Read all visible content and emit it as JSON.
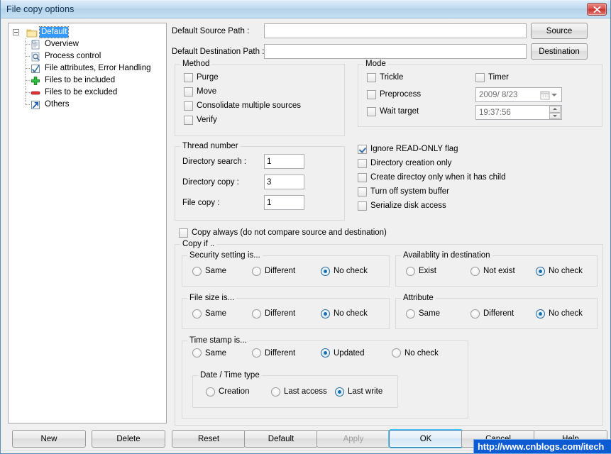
{
  "window": {
    "title": "File copy options",
    "close_icon": "close-icon"
  },
  "tree": {
    "root": {
      "label": "Default",
      "icon": "folder-icon",
      "selected": true
    },
    "items": [
      {
        "label": "Overview",
        "icon": "document-icon"
      },
      {
        "label": "Process control",
        "icon": "magnifier-icon"
      },
      {
        "label": "File attributes, Error Handling",
        "icon": "checkmark-icon"
      },
      {
        "label": "Files to be included",
        "icon": "green-plus-icon"
      },
      {
        "label": "Files to be excluded",
        "icon": "red-minus-icon"
      },
      {
        "label": "Others",
        "icon": "blue-arrow-icon"
      }
    ]
  },
  "paths": {
    "source_label": "Default Source Path :",
    "source_value": "",
    "source_placeholder": "",
    "source_button": "Source",
    "destination_label": "Default Destination Path :",
    "destination_value": "",
    "destination_placeholder": "",
    "destination_button": "Destination"
  },
  "method": {
    "legend": "Method",
    "items": [
      {
        "label": "Purge",
        "checked": false
      },
      {
        "label": "Move",
        "checked": false
      },
      {
        "label": "Consolidate multiple sources",
        "checked": false
      },
      {
        "label": "Verify",
        "checked": false
      }
    ]
  },
  "mode": {
    "legend": "Mode",
    "items": [
      {
        "label": "Trickle",
        "checked": false
      },
      {
        "label": "Preprocess",
        "checked": false
      },
      {
        "label": "Wait target",
        "checked": false
      }
    ],
    "timer": {
      "label": "Timer",
      "checked": false
    },
    "date_value": "2009/  8/23",
    "time_value": "19:37:56"
  },
  "thread": {
    "legend": "Thread number",
    "rows": [
      {
        "label": "Directory search :",
        "value": "1"
      },
      {
        "label": "Directory copy :",
        "value": "3"
      },
      {
        "label": "File copy :",
        "value": "1"
      }
    ]
  },
  "flags": [
    {
      "label": "Ignore READ-ONLY flag",
      "checked": true
    },
    {
      "label": "Directory creation only",
      "checked": false
    },
    {
      "label": "Create directoy only when it has child",
      "checked": false
    },
    {
      "label": "Turn off system buffer",
      "checked": false
    },
    {
      "label": "Serialize disk access",
      "checked": false
    }
  ],
  "copy_always": {
    "label": "Copy always (do not compare source and destination)",
    "checked": false
  },
  "copy_if": {
    "legend": "Copy if ..",
    "security": {
      "legend": "Security setting is...",
      "options": [
        {
          "label": "Same",
          "checked": false
        },
        {
          "label": "Different",
          "checked": false
        },
        {
          "label": "No check",
          "checked": true
        }
      ]
    },
    "availability": {
      "legend": "Availablity in destination",
      "options": [
        {
          "label": "Exist",
          "checked": false
        },
        {
          "label": "Not exist",
          "checked": false
        },
        {
          "label": "No check",
          "checked": true
        }
      ]
    },
    "filesize": {
      "legend": "File size is...",
      "options": [
        {
          "label": "Same",
          "checked": false
        },
        {
          "label": "Different",
          "checked": false
        },
        {
          "label": "No check",
          "checked": true
        }
      ]
    },
    "attribute": {
      "legend": "Attribute",
      "options": [
        {
          "label": "Same",
          "checked": false
        },
        {
          "label": "Different",
          "checked": false
        },
        {
          "label": "No check",
          "checked": true
        }
      ]
    },
    "timestamp": {
      "legend": "Time stamp is...",
      "options": [
        {
          "label": "Same",
          "checked": false
        },
        {
          "label": "Different",
          "checked": false
        },
        {
          "label": "Updated",
          "checked": true
        },
        {
          "label": "No check",
          "checked": false
        }
      ],
      "datetime_type": {
        "legend": "Date / Time type",
        "options": [
          {
            "label": "Creation",
            "checked": false
          },
          {
            "label": "Last access",
            "checked": false
          },
          {
            "label": "Last write",
            "checked": true
          }
        ]
      }
    }
  },
  "buttons": {
    "new": "New",
    "delete": "Delete",
    "reset": "Reset",
    "default": "Default",
    "apply": "Apply",
    "ok": "OK",
    "cancel": "Cancel",
    "help": "Help"
  },
  "overlay": {
    "url": "http://www.cnblogs.com/itech"
  },
  "colors": {
    "accent": "#3399ff",
    "title_gradient_top": "#d9e9f7",
    "close_red": "#c9302c",
    "focus_blue": "#4fc0ef",
    "overlay_blue": "#0b5bd3"
  }
}
